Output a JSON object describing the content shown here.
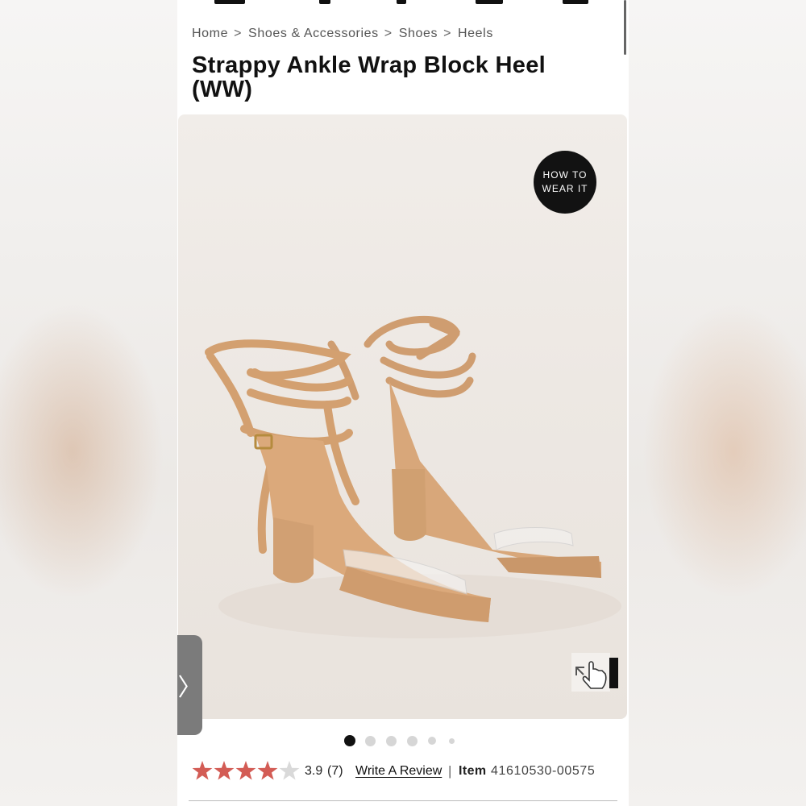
{
  "breadcrumb": {
    "items": [
      "Home",
      "Shoes & Accessories",
      "Shoes",
      "Heels"
    ],
    "separator": ">"
  },
  "product": {
    "title": "Strappy Ankle Wrap Block Heel (WW)",
    "how_to_wear_line1": "HOW TO",
    "how_to_wear_line2": "WEAR IT",
    "next_arrow": "〉",
    "gallery": {
      "image_count": 6,
      "active_index": 0
    }
  },
  "rating": {
    "value": "3.9",
    "count": "(7)",
    "stars_filled": 4,
    "stars_total": 5,
    "star_color": "#d35c55",
    "star_empty_color": "#d9d9d9"
  },
  "review_link": "Write A Review",
  "item": {
    "label": "Item",
    "number": "41610530-00575"
  },
  "colors": {
    "shoe": "#d8a77a",
    "shoe_shadow": "#c08f63",
    "badge_bg": "#121212"
  }
}
